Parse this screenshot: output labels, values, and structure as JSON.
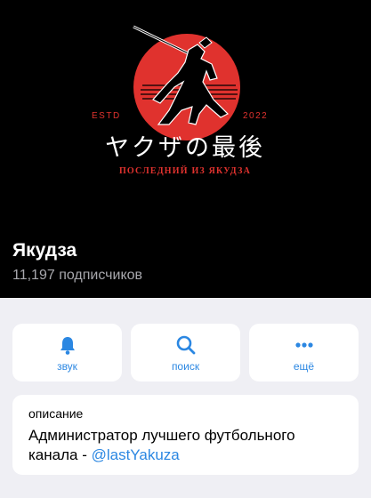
{
  "colors": {
    "accent": "#2b87e2",
    "logo_red": "#e0322e",
    "header_bg": "#000000"
  },
  "logo": {
    "estd": "ESTD",
    "year": "2022",
    "japanese": "ヤクザの最後",
    "subtitle": "ПОСЛЕДНИЙ ИЗ ЯКУДЗА"
  },
  "channel": {
    "title": "Якудза",
    "subscribers": "11,197 подписчиков"
  },
  "actions": [
    {
      "label": "звук",
      "icon": "bell-icon"
    },
    {
      "label": "поиск",
      "icon": "search-icon"
    },
    {
      "label": "ещё",
      "icon": "more-icon"
    }
  ],
  "description": {
    "caption": "описание",
    "text_line1": "Администратор лучшего футбольного",
    "text_prefix": "канала  - ",
    "mention": "@lastYakuza"
  }
}
